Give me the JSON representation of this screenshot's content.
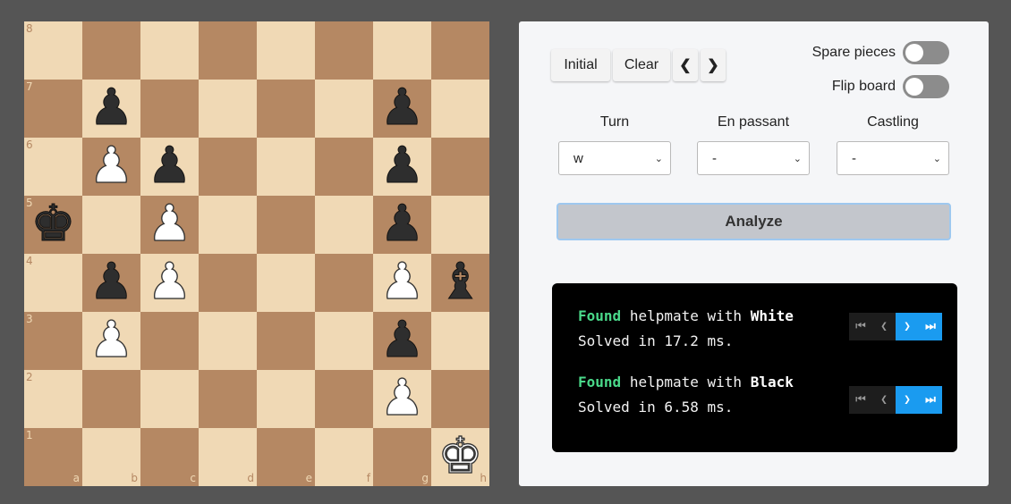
{
  "board": {
    "ranks": [
      "8",
      "7",
      "6",
      "5",
      "4",
      "3",
      "2",
      "1"
    ],
    "files": [
      "a",
      "b",
      "c",
      "d",
      "e",
      "f",
      "g",
      "h"
    ],
    "pieces": [
      {
        "square": "b7",
        "color": "black",
        "type": "pawn",
        "glyph": "♟"
      },
      {
        "square": "g7",
        "color": "black",
        "type": "pawn",
        "glyph": "♟"
      },
      {
        "square": "b6",
        "color": "white",
        "type": "pawn",
        "glyph": "♟"
      },
      {
        "square": "c6",
        "color": "black",
        "type": "pawn",
        "glyph": "♟"
      },
      {
        "square": "g6",
        "color": "black",
        "type": "pawn",
        "glyph": "♟"
      },
      {
        "square": "a5",
        "color": "black",
        "type": "king",
        "glyph": "♚"
      },
      {
        "square": "c5",
        "color": "white",
        "type": "pawn",
        "glyph": "♟"
      },
      {
        "square": "g5",
        "color": "black",
        "type": "pawn",
        "glyph": "♟"
      },
      {
        "square": "b4",
        "color": "black",
        "type": "pawn",
        "glyph": "♟"
      },
      {
        "square": "c4",
        "color": "white",
        "type": "pawn",
        "glyph": "♟"
      },
      {
        "square": "g4",
        "color": "white",
        "type": "pawn",
        "glyph": "♟"
      },
      {
        "square": "h4",
        "color": "black",
        "type": "bishop",
        "glyph": "♝"
      },
      {
        "square": "b3",
        "color": "white",
        "type": "pawn",
        "glyph": "♟"
      },
      {
        "square": "g3",
        "color": "black",
        "type": "pawn",
        "glyph": "♟"
      },
      {
        "square": "g2",
        "color": "white",
        "type": "pawn",
        "glyph": "♟"
      },
      {
        "square": "h1",
        "color": "white",
        "type": "king",
        "glyph": "♚"
      }
    ],
    "colors": {
      "light": "#f0d9b5",
      "dark": "#b58863"
    }
  },
  "controls": {
    "initial_label": "Initial",
    "clear_label": "Clear",
    "prev_icon": "chevron-left-icon",
    "next_icon": "chevron-right-icon",
    "spare_pieces_label": "Spare pieces",
    "flip_board_label": "Flip board",
    "spare_pieces_on": false,
    "flip_board_on": false
  },
  "fields": {
    "turn": {
      "label": "Turn",
      "value": "w"
    },
    "en_passant": {
      "label": "En passant",
      "value": "-"
    },
    "castling": {
      "label": "Castling",
      "value": "-"
    }
  },
  "analyze_label": "Analyze",
  "results": [
    {
      "found": "Found",
      "text": "helpmate with",
      "side": "White",
      "time": "Solved in 17.2 ms."
    },
    {
      "found": "Found",
      "text": "helpmate with",
      "side": "Black",
      "time": "Solved in 6.58 ms."
    }
  ],
  "nav_icons": [
    "first-icon",
    "prev-icon",
    "next-icon",
    "last-icon"
  ],
  "accent": "#1a9bf0",
  "found_color": "#4ad98a"
}
